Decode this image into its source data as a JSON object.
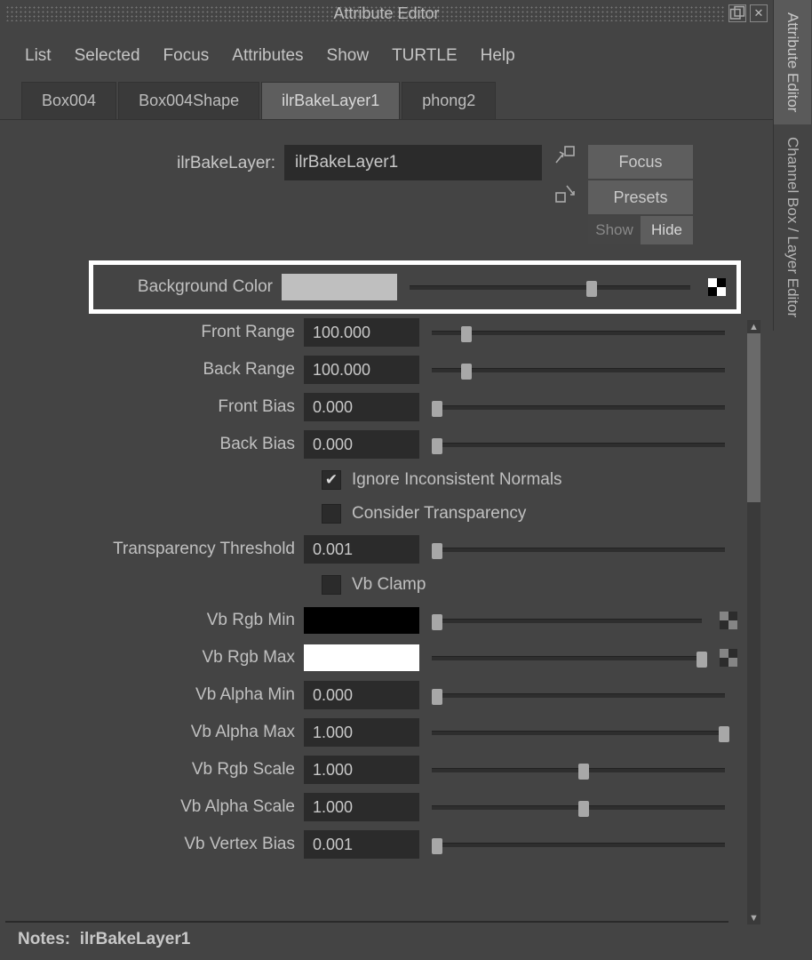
{
  "title": "Attribute Editor",
  "sideTabs": {
    "active": "Attribute Editor",
    "inactive": "Channel Box / Layer Editor"
  },
  "menu": [
    "List",
    "Selected",
    "Focus",
    "Attributes",
    "Show",
    "TURTLE",
    "Help"
  ],
  "tabs": [
    "Box004",
    "Box004Shape",
    "ilrBakeLayer1",
    "phong2"
  ],
  "activeTab": "ilrBakeLayer1",
  "nodeTypeLabel": "ilrBakeLayer:",
  "nodeName": "ilrBakeLayer1",
  "buttons": {
    "focus": "Focus",
    "presets": "Presets",
    "show": "Show",
    "hide": "Hide"
  },
  "attributes": {
    "backgroundColor": {
      "label": "Background Color",
      "color": "#bfbfbf",
      "sliderPos": 63
    },
    "frontRange": {
      "label": "Front Range",
      "value": "100.000",
      "sliderPos": 10
    },
    "backRange": {
      "label": "Back Range",
      "value": "100.000",
      "sliderPos": 10
    },
    "frontBias": {
      "label": "Front Bias",
      "value": "0.000",
      "sliderPos": 0
    },
    "backBias": {
      "label": "Back Bias",
      "value": "0.000",
      "sliderPos": 0
    },
    "ignoreInconsistent": {
      "label": "Ignore Inconsistent Normals",
      "checked": true
    },
    "considerTransparency": {
      "label": "Consider Transparency",
      "checked": false
    },
    "transparencyThreshold": {
      "label": "Transparency Threshold",
      "value": "0.001",
      "sliderPos": 0
    },
    "vbClamp": {
      "label": "Vb Clamp",
      "checked": false
    },
    "vbRgbMin": {
      "label": "Vb Rgb Min",
      "color": "#000000",
      "sliderPos": 0
    },
    "vbRgbMax": {
      "label": "Vb Rgb Max",
      "color": "#ffffff",
      "sliderPos": 98
    },
    "vbAlphaMin": {
      "label": "Vb Alpha Min",
      "value": "0.000",
      "sliderPos": 0
    },
    "vbAlphaMax": {
      "label": "Vb Alpha Max",
      "value": "1.000",
      "sliderPos": 98
    },
    "vbRgbScale": {
      "label": "Vb Rgb Scale",
      "value": "1.000",
      "sliderPos": 50
    },
    "vbAlphaScale": {
      "label": "Vb Alpha Scale",
      "value": "1.000",
      "sliderPos": 50
    },
    "vbVertexBias": {
      "label": "Vb Vertex Bias",
      "value": "0.001",
      "sliderPos": 0
    }
  },
  "notesLabel": "Notes:",
  "notesNode": "ilrBakeLayer1"
}
